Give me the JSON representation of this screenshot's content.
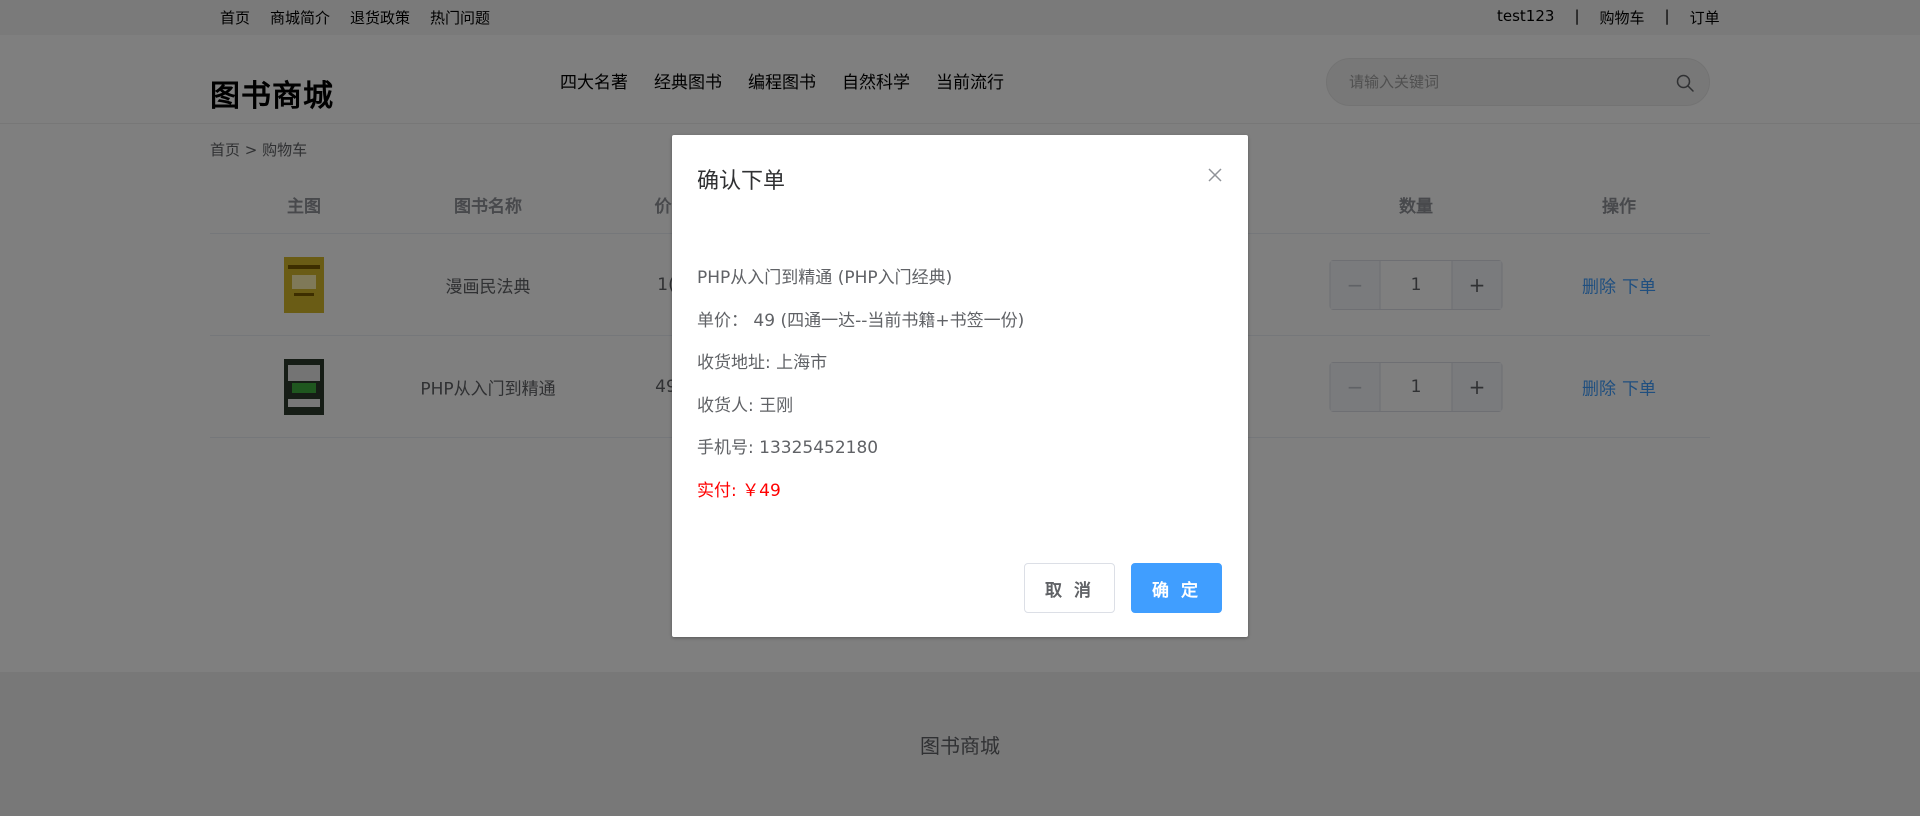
{
  "topbar": {
    "left_links": [
      "首页",
      "商城简介",
      "退货政策",
      "热门问题"
    ],
    "username": "test123",
    "sep1": "|",
    "cart_link": "购物车",
    "sep2": "|",
    "orders_link": "订单"
  },
  "header": {
    "logo": "图书商城",
    "nav": [
      "四大名著",
      "经典图书",
      "编程图书",
      "自然科学",
      "当前流行"
    ],
    "search_placeholder": "请输入关键词"
  },
  "breadcrumb": "首页 > 购物车",
  "table": {
    "headers": {
      "image": "主图",
      "name": "图书名称",
      "price": "价",
      "qty": "数量",
      "ops": "操作"
    },
    "rows": [
      {
        "name": "漫画民法典",
        "price_partial": "1(",
        "qty": "1",
        "delete": "删除",
        "order": "下单",
        "cover_color": "#d4b82a"
      },
      {
        "name": "PHP从入门到精通",
        "price_partial": "49",
        "qty": "1",
        "delete": "删除",
        "order": "下单",
        "cover_color": "#2c3a2c"
      }
    ]
  },
  "footer": {
    "text": "图书商城"
  },
  "dialog": {
    "title": "确认下单",
    "book": "PHP从入门到精通 (PHP入门经典)",
    "price_line": "单价：  49 (四通一达--当前书籍+书签一份)",
    "address_line": "收货地址: 上海市",
    "receiver_line": "收货人: 王刚",
    "phone_line": "手机号: 13325452180",
    "pay_line": "实付: ￥49",
    "cancel": "取 消",
    "confirm": "确 定"
  },
  "colors": {
    "accent": "#409eff",
    "pay": "#ff0000"
  }
}
